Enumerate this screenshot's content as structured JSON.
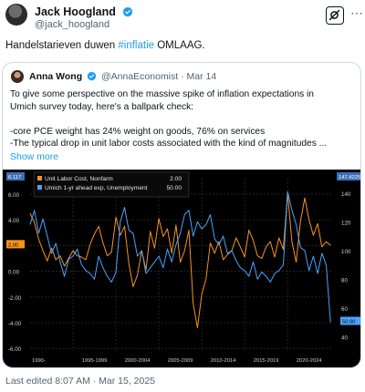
{
  "author": {
    "name": "Jack Hoogland",
    "handle": "@jack_hoogland"
  },
  "tweet": {
    "text_before": "Handelstarieven duwen ",
    "hashtag": "#inflatie",
    "text_after": " OMLAAG."
  },
  "quoted": {
    "name": "Anna Wong",
    "handle": "@AnnaEconomist",
    "separator": "·",
    "date": "Mar 14",
    "lines": [
      "To give some perspective on the massive spike of inflation expectations in",
      "Umich survey today, here's a ballpark check:",
      "",
      "-core PCE weight has 24% weight on goods, 76% on services",
      "-The typical drop in unit labor costs associated with the kind of magnitudes ..."
    ],
    "show_more": "Show more"
  },
  "footer": {
    "edited": "Last edited 8:07 AM · Mar 15, 2025"
  },
  "icons": {
    "verified": "verified-badge-icon",
    "grok": "grok-icon",
    "more": "more-options-icon"
  },
  "colors": {
    "verified": "#1d9bf0",
    "link": "#1d9bf0",
    "orange_series": "#f7931e",
    "blue_series": "#4aa3ff"
  },
  "chart_data": {
    "type": "line",
    "legend": [
      {
        "name": "Unit Labor Cost, Nonfarm",
        "value": "2.00",
        "color": "#f7931e"
      },
      {
        "name": "Umich 1-yr ahead exp, Unemployment",
        "value": "50.00",
        "color": "#4aa3ff"
      }
    ],
    "x_ticks": [
      "1990-",
      "1995-1999",
      "2000-2004",
      "2005-2009",
      "2010-2014",
      "2015-2019",
      "2020-2024"
    ],
    "left_axis": {
      "ticks": [
        "6.00",
        "4.00",
        "2.00",
        "0.00",
        "-2.00",
        "-4.00",
        "-6.00"
      ],
      "ylim": [
        -6.2,
        7.2
      ],
      "top_badge": "6.117",
      "last_badge": "2.00"
    },
    "right_axis": {
      "ticks": [
        "140",
        "120",
        "100",
        "80",
        "60",
        "40"
      ],
      "ylim": [
        30,
        150
      ],
      "top_badge": "147.4225",
      "last_badge": "50.00"
    },
    "series": [
      {
        "name": "Unit Labor Cost, Nonfarm",
        "axis": "left",
        "color": "#f7931e",
        "x": [
          1990,
          1990.5,
          1991,
          1991.5,
          1992,
          1992.5,
          1993,
          1993.5,
          1994,
          1994.5,
          1995,
          1995.5,
          1996,
          1996.5,
          1997,
          1997.5,
          1998,
          1998.5,
          1999,
          1999.5,
          2000,
          2000.5,
          2001,
          2001.5,
          2002,
          2002.5,
          2003,
          2003.5,
          2004,
          2004.5,
          2005,
          2005.5,
          2006,
          2006.5,
          2007,
          2007.5,
          2008,
          2008.5,
          2009,
          2009.5,
          2010,
          2010.5,
          2011,
          2011.5,
          2012,
          2012.5,
          2013,
          2013.5,
          2014,
          2014.5,
          2015,
          2015.5,
          2016,
          2016.5,
          2017,
          2017.5,
          2018,
          2018.5,
          2019,
          2019.5,
          2020,
          2020.5,
          2021,
          2021.5,
          2022,
          2022.5,
          2023,
          2023.5,
          2024,
          2024.5,
          2025
        ],
        "values": [
          4.5,
          3.8,
          2.5,
          1.6,
          0.8,
          1.8,
          0.9,
          1.2,
          0.4,
          1.0,
          1.6,
          1.2,
          1.1,
          0.9,
          2.1,
          2.9,
          3.5,
          2.2,
          1.2,
          1.5,
          4.2,
          2.8,
          3.5,
          0.6,
          -1.2,
          -0.3,
          1.6,
          0.1,
          3.1,
          1.8,
          4.1,
          2.7,
          3.3,
          1.4,
          3.6,
          0.7,
          1.6,
          3.2,
          -2.5,
          -4.4,
          -1.8,
          -0.6,
          2.2,
          1.4,
          2.3,
          0.9,
          1.3,
          1.6,
          2.6,
          1.9,
          1.1,
          3.2,
          2.4,
          1.2,
          1.0,
          1.9,
          2.3,
          1.1,
          2.6,
          1.7,
          6.1,
          2.3,
          0.7,
          3.9,
          5.7,
          4.0,
          2.8,
          3.7,
          1.9,
          2.3,
          2.0
        ]
      },
      {
        "name": "Umich 1-yr ahead exp, Unemployment",
        "axis": "right",
        "color": "#4aa3ff",
        "x": [
          1990,
          1990.5,
          1991,
          1991.5,
          1992,
          1992.5,
          1993,
          1993.5,
          1994,
          1994.5,
          1995,
          1995.5,
          1996,
          1996.5,
          1997,
          1997.5,
          1998,
          1998.5,
          1999,
          1999.5,
          2000,
          2000.5,
          2001,
          2001.5,
          2002,
          2002.5,
          2003,
          2003.5,
          2004,
          2004.5,
          2005,
          2005.5,
          2006,
          2006.5,
          2007,
          2007.5,
          2008,
          2008.5,
          2009,
          2009.5,
          2010,
          2010.5,
          2011,
          2011.5,
          2012,
          2012.5,
          2013,
          2013.5,
          2014,
          2014.5,
          2015,
          2015.5,
          2016,
          2016.5,
          2017,
          2017.5,
          2018,
          2018.5,
          2019,
          2019.5,
          2020,
          2020.5,
          2021,
          2021.5,
          2022,
          2022.5,
          2023,
          2023.5,
          2024,
          2024.5,
          2025
        ],
        "values": [
          118,
          128,
          112,
          122,
          110,
          98,
          105,
          92,
          82,
          94,
          96,
          101,
          90,
          86,
          84,
          80,
          96,
          88,
          82,
          78,
          85,
          120,
          130,
          114,
          112,
          96,
          100,
          84,
          88,
          92,
          96,
          88,
          101,
          92,
          104,
          112,
          125,
          128,
          110,
          120,
          115,
          118,
          125,
          108,
          104,
          110,
          98,
          100,
          93,
          88,
          86,
          82,
          92,
          80,
          85,
          82,
          78,
          84,
          86,
          90,
          141,
          128,
          118,
          102,
          100,
          86,
          96,
          84,
          98,
          90,
          50
        ]
      }
    ]
  }
}
